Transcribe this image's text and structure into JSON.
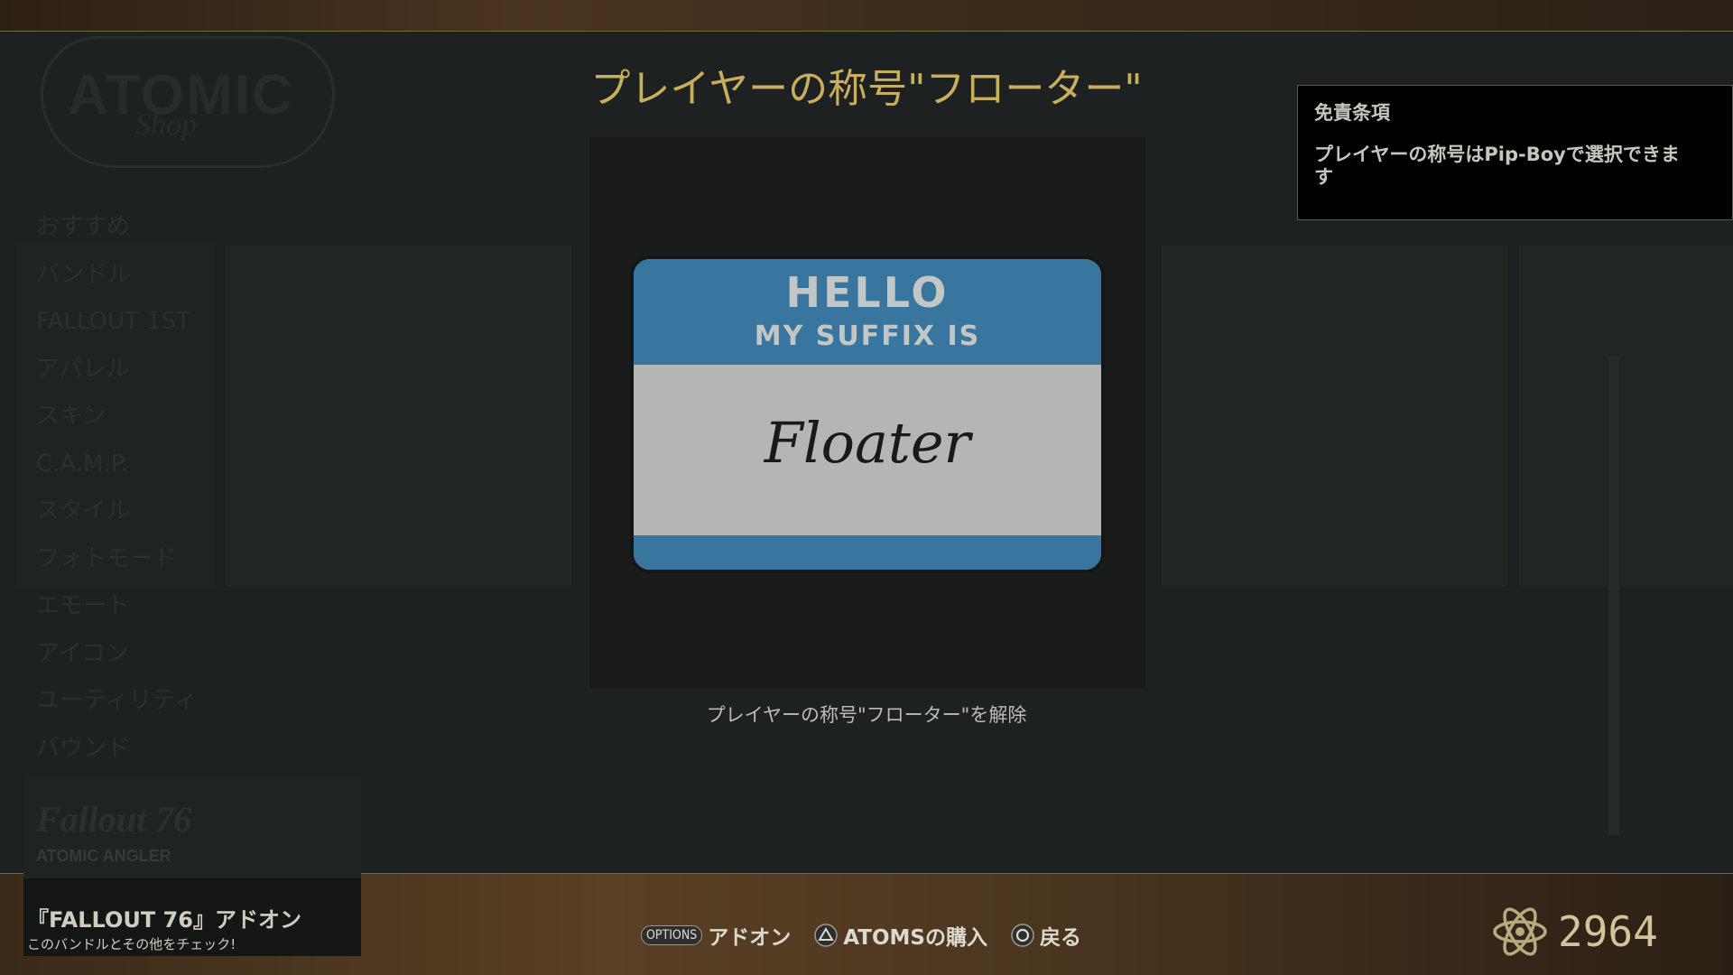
{
  "shop": {
    "logo_text": "ATOMIC",
    "logo_sub": "Shop",
    "categories": [
      "おすすめ",
      "バンドル",
      "FALLOUT 1ST",
      "アパレル",
      "スキン",
      "C.A.M.P.",
      "スタイル",
      "フォトモード",
      "エモート",
      "アイコン",
      "ユーティリティ",
      "バウンド"
    ]
  },
  "item": {
    "title": "プレイヤーの称号\"フローター\"",
    "caption": "プレイヤーの称号\"フローター\"を解除",
    "tag_hello": "HELLO",
    "tag_my": "MY SUFFIX IS",
    "tag_name": "Floater"
  },
  "disclaimer": {
    "title": "免責条項",
    "body": "プレイヤーの称号はPip-Boyで選択できます"
  },
  "promo": {
    "logo": "Fallout 76",
    "sub": "ATOMIC ANGLER",
    "title": "『FALLOUT 76』アドオン",
    "subtitle": "このバンドルとその他をチェック!"
  },
  "footer": {
    "options_key": "OPTIONS",
    "addon_label": "アドオン",
    "buy_label": "ATOMSの購入",
    "back_label": "戻る"
  },
  "atoms": {
    "value": "2964"
  },
  "colors": {
    "title": "#c9ae5c",
    "tag_blue": "#3876a0",
    "tag_body": "#b4b6b5"
  }
}
